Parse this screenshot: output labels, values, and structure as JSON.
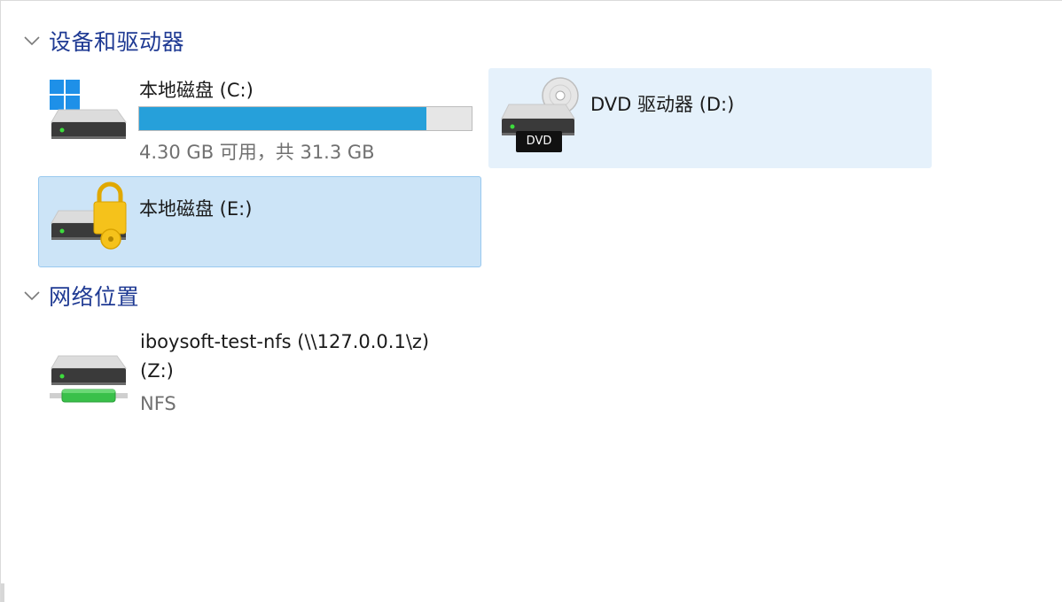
{
  "groups": {
    "devices": {
      "title": "设备和驱动器"
    },
    "network": {
      "title": "网络位置"
    }
  },
  "drives": {
    "c": {
      "name": "本地磁盘 (C:)",
      "free_text": "4.30 GB 可用，共 31.3 GB",
      "used_fraction": 0.863,
      "bar_color": "#26a0da"
    },
    "d": {
      "name": "DVD 驱动器 (D:)",
      "badge": "DVD"
    },
    "e": {
      "name": "本地磁盘 (E:)"
    },
    "z": {
      "name_line1": "iboysoft-test-nfs (\\\\127.0.0.1\\z)",
      "name_line2": "(Z:)",
      "type": "NFS"
    }
  },
  "colors": {
    "group_title": "#1f3a93",
    "selection_bg": "#cce4f7",
    "selection_border": "#99c9ef",
    "hover_bg": "#e5f1fb"
  },
  "icons": {
    "chevron": "chevron-down-icon",
    "windows": "windows-logo-icon",
    "hdd": "hard-drive-icon",
    "dvd": "dvd-disc-icon",
    "lock": "bitlocker-lock-icon",
    "network": "network-drive-icon"
  }
}
